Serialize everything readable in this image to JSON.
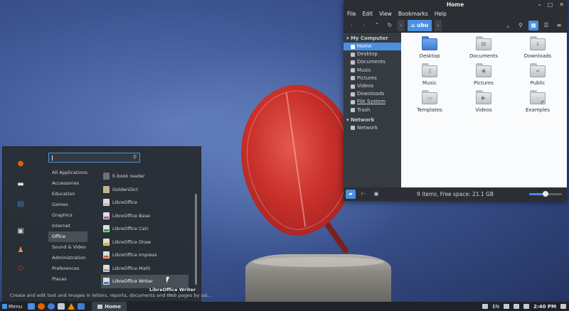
{
  "file_manager": {
    "title": "Home",
    "window_controls": [
      "minimize-icon",
      "maximize-icon",
      "close-icon"
    ],
    "menubar": [
      "File",
      "Edit",
      "View",
      "Bookmarks",
      "Help"
    ],
    "toolbar": {
      "icons": [
        "back-icon",
        "forward-icon",
        "up-icon",
        "reload-icon",
        "open-terminal-icon",
        "search-icon",
        "icon-view-icon",
        "list-view-icon",
        "compact-view-icon"
      ],
      "breadcrumb": "ubu"
    },
    "sidebar": {
      "sections": [
        {
          "header": "My Computer",
          "items": [
            {
              "label": "Home",
              "icon": "home-icon",
              "active": true
            },
            {
              "label": "Desktop",
              "icon": "desktop-icon"
            },
            {
              "label": "Documents",
              "icon": "documents-icon"
            },
            {
              "label": "Music",
              "icon": "music-icon"
            },
            {
              "label": "Pictures",
              "icon": "pictures-icon"
            },
            {
              "label": "Videos",
              "icon": "videos-icon"
            },
            {
              "label": "Downloads",
              "icon": "downloads-icon"
            },
            {
              "label": "File System",
              "icon": "drive-icon"
            },
            {
              "label": "Trash",
              "icon": "trash-icon"
            }
          ]
        },
        {
          "header": "Network",
          "items": [
            {
              "label": "Network",
              "icon": "network-icon"
            }
          ]
        }
      ]
    },
    "files": [
      {
        "label": "Desktop",
        "icon": "desktop-folder-icon"
      },
      {
        "label": "Documents",
        "icon": "documents-folder-icon"
      },
      {
        "label": "Downloads",
        "icon": "downloads-folder-icon"
      },
      {
        "label": "Music",
        "icon": "music-folder-icon"
      },
      {
        "label": "Pictures",
        "icon": "pictures-folder-icon"
      },
      {
        "label": "Public",
        "icon": "public-folder-icon"
      },
      {
        "label": "Templates",
        "icon": "templates-folder-icon"
      },
      {
        "label": "Videos",
        "icon": "videos-folder-icon"
      },
      {
        "label": "Examples",
        "icon": "examples-folder-icon"
      }
    ],
    "status": {
      "text": "9 items, Free space: 21.1 GB",
      "zoom_level": 0.5
    }
  },
  "app_menu": {
    "favorites": [
      {
        "name": "firefox-icon",
        "color": "#e66000"
      },
      {
        "name": "files-icon",
        "color": "#e6e9ec"
      },
      {
        "name": "document-icon",
        "color": "#3d7ed8"
      },
      {
        "name": "system-settings-icon",
        "color": "#d0d5da"
      },
      {
        "name": "user-icon",
        "color": "#e98a5a"
      },
      {
        "name": "power-icon",
        "color": "#d9342b"
      }
    ],
    "search": {
      "value": ""
    },
    "categories": [
      {
        "label": "All Applications"
      },
      {
        "label": "Accessories"
      },
      {
        "label": "Education"
      },
      {
        "label": "Games"
      },
      {
        "label": "Graphics"
      },
      {
        "label": "Internet"
      },
      {
        "label": "Office",
        "active": true
      },
      {
        "label": "Sound & Video"
      },
      {
        "label": "Administration"
      },
      {
        "label": "Preferences"
      },
      {
        "label": "Places"
      }
    ],
    "apps": [
      {
        "label": "E-book reader",
        "icon": "ebook"
      },
      {
        "label": "GoldenDict",
        "icon": "gd"
      },
      {
        "label": "LibreOffice",
        "icon": "lo"
      },
      {
        "label": "LibreOffice Base",
        "icon": "base"
      },
      {
        "label": "LibreOffice Calc",
        "icon": "calc"
      },
      {
        "label": "LibreOffice Draw",
        "icon": "draw"
      },
      {
        "label": "LibreOffice Impress",
        "icon": "impress"
      },
      {
        "label": "LibreOffice Math",
        "icon": "math"
      },
      {
        "label": "LibreOffice Writer",
        "icon": "writer",
        "hover": true
      }
    ],
    "description": "Create and edit text and images in letters, reports, documents and Web pages by usi...",
    "tooltip": "LibreOffice Writer"
  },
  "taskbar": {
    "menu_label": "Menu",
    "launchers": [
      {
        "name": "show-desktop-icon",
        "color": "#4a8fe0"
      },
      {
        "name": "firefox-icon",
        "color": "#e66000"
      },
      {
        "name": "thunderbird-icon",
        "color": "#3d7ed8"
      },
      {
        "name": "files-icon",
        "color": "#c5cbd1"
      },
      {
        "name": "vlc-icon",
        "color": "#f08a00"
      },
      {
        "name": "libreoffice-writer-icon",
        "color": "#3d7ed8"
      }
    ],
    "task": "Home",
    "tray": {
      "language": "EN",
      "clock": "2:40 PM"
    }
  }
}
